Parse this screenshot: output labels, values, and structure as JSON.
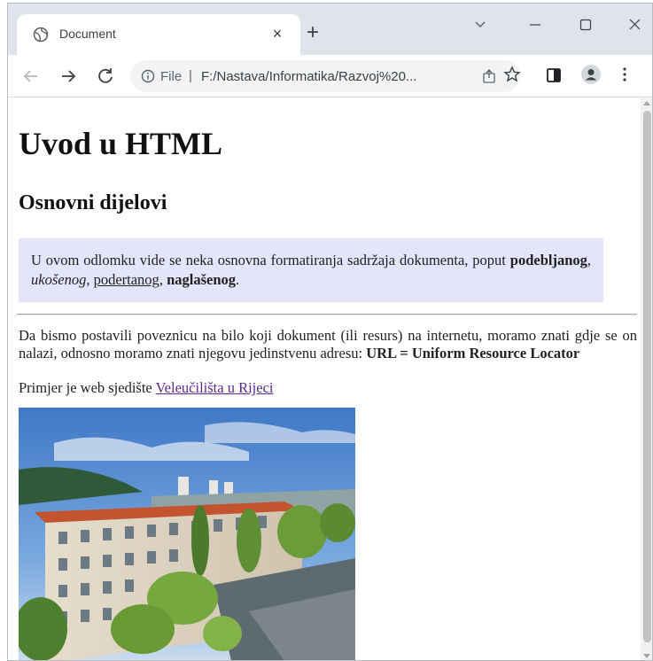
{
  "tab": {
    "title": "Document",
    "close": "×",
    "new_tab": "+"
  },
  "toolbar": {
    "scheme_label": "File",
    "separator": "|",
    "url": "F:/Nastava/Informatika/Razvoj%20..."
  },
  "page": {
    "h1": "Uvod u HTML",
    "h2": "Osnovni dijelovi",
    "note": {
      "lead": "U ovom odlomku vide se neka osnovna formatiranja sadržaja dokumenta, poput ",
      "bold": "podebljanog",
      "comma1": ", ",
      "italic": "ukošenog",
      "comma2": ", ",
      "underline": "podertanog",
      "comma3": ", ",
      "strong": "naglašenog",
      "end": "."
    },
    "para": {
      "text": "Da bismo postavili poveznicu na bilo koji dokument (ili resurs) na internetu, moramo znati gdje se on nalazi, odnosno moramo znati njegovu jedinstvenu adresu: ",
      "bold": "URL = Uniform Resource Locator"
    },
    "example": {
      "text": "Primjer je web sjedište ",
      "link": "Veleučilišta u Rijeci"
    }
  },
  "colors": {
    "tabstrip": "#dfe3ea",
    "note_bg": "#e4e4fb",
    "visited_link": "#5b2a91"
  }
}
